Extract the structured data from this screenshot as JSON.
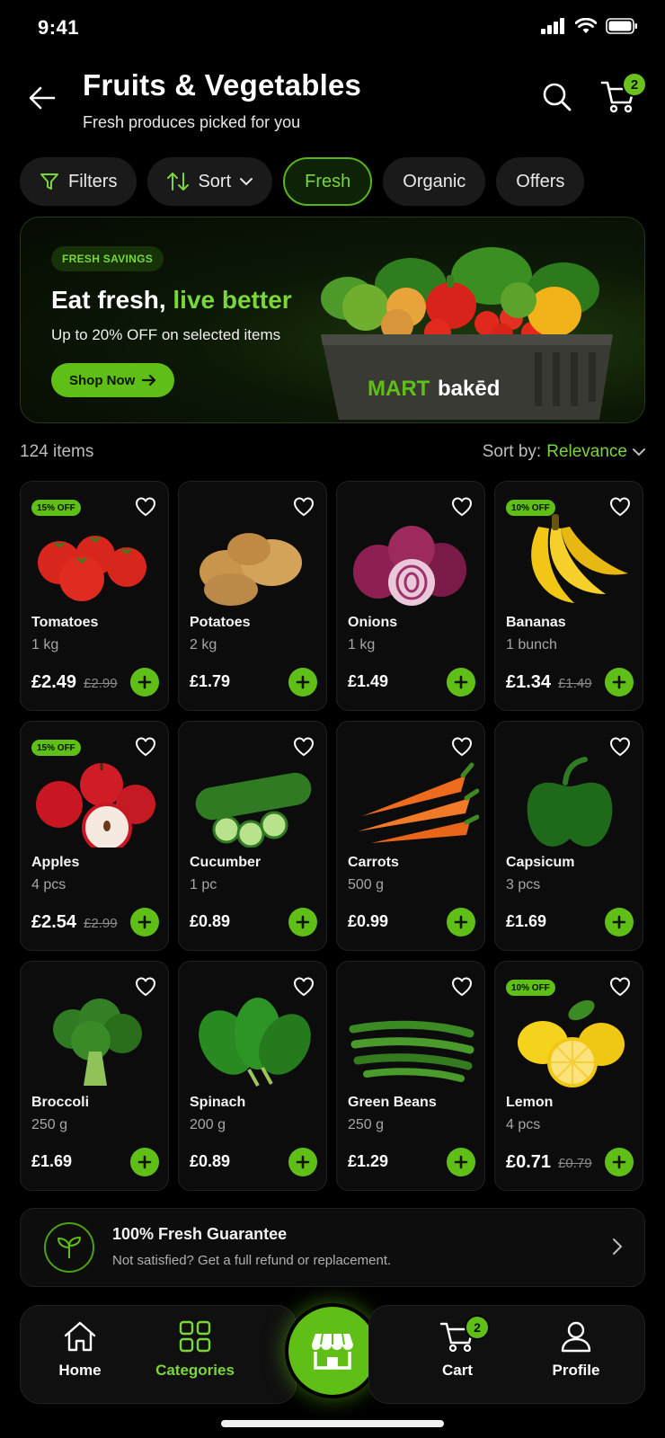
{
  "status": {
    "time": "9:41"
  },
  "header": {
    "title": "Fruits & Vegetables",
    "subtitle": "Fresh produces picked for you",
    "cart_count": "2"
  },
  "chips": [
    {
      "label": "Filters",
      "icon": "filter-icon"
    },
    {
      "label": "Sort",
      "icon": "sort-icon"
    },
    {
      "label": "Fresh",
      "active": true
    },
    {
      "label": "Organic"
    },
    {
      "label": "Offers"
    }
  ],
  "banner": {
    "tag": "FRESH SAVINGS",
    "title_a": "Eat fresh,",
    "title_b": "live better",
    "subtitle": "Up to 20% OFF on selected items",
    "cta": "Shop Now",
    "brand_a": "MART",
    "brand_b": "bakēd"
  },
  "results": {
    "count": "124 items",
    "sort_label": "Sort by:",
    "sort_value": "Relevance"
  },
  "products": [
    {
      "name": "Tomatoes",
      "qty": "1 kg",
      "price": "£2.49",
      "old_price": "£2.99",
      "badge": "15% OFF",
      "icon": "tomato-icon",
      "color": "#d9261c"
    },
    {
      "name": "Potatoes",
      "qty": "2 kg",
      "price": "£1.79",
      "icon": "potato-icon",
      "color": "#c8954a"
    },
    {
      "name": "Onions",
      "qty": "1 kg",
      "price": "£1.49",
      "icon": "onion-icon",
      "color": "#8e1f52"
    },
    {
      "name": "Bananas",
      "qty": "1 bunch",
      "price": "£1.34",
      "old_price": "£1.49",
      "badge": "10% OFF",
      "icon": "banana-icon",
      "color": "#f2c614"
    },
    {
      "name": "Apples",
      "qty": "4 pcs",
      "price": "£2.54",
      "old_price": "£2.99",
      "badge": "15% OFF",
      "icon": "apple-icon",
      "color": "#c81622"
    },
    {
      "name": "Cucumber",
      "qty": "1 pc",
      "price": "£0.89",
      "icon": "cucumber-icon",
      "color": "#2f7a22"
    },
    {
      "name": "Carrots",
      "qty": "500 g",
      "price": "£0.99",
      "icon": "carrot-icon",
      "color": "#ee6a1c"
    },
    {
      "name": "Capsicum",
      "qty": "3 pcs",
      "price": "£1.69",
      "icon": "capsicum-icon",
      "color": "#1f6a1a"
    },
    {
      "name": "Broccoli",
      "qty": "250 g",
      "price": "£1.69",
      "icon": "broccoli-icon",
      "color": "#2f7a22"
    },
    {
      "name": "Spinach",
      "qty": "200 g",
      "price": "£0.89",
      "icon": "spinach-icon",
      "color": "#2a8a22"
    },
    {
      "name": "Green Beans",
      "qty": "250 g",
      "price": "£1.29",
      "icon": "green-beans-icon",
      "color": "#3c8a24"
    },
    {
      "name": "Lemon",
      "qty": "4 pcs",
      "price": "£0.71",
      "old_price": "£0.79",
      "badge": "10% OFF",
      "icon": "lemon-icon",
      "color": "#f5d21c"
    }
  ],
  "guarantee": {
    "title": "100% Fresh Guarantee",
    "subtitle": "Not satisfied? Get a full refund or replacement."
  },
  "tabbar": {
    "home": "Home",
    "categories": "Categories",
    "cart": "Cart",
    "cart_count": "2",
    "profile": "Profile"
  },
  "colors": {
    "accent": "#5fbf16",
    "accent_text": "#7ad63a",
    "background": "#000000",
    "card": "#0c0c0c"
  }
}
